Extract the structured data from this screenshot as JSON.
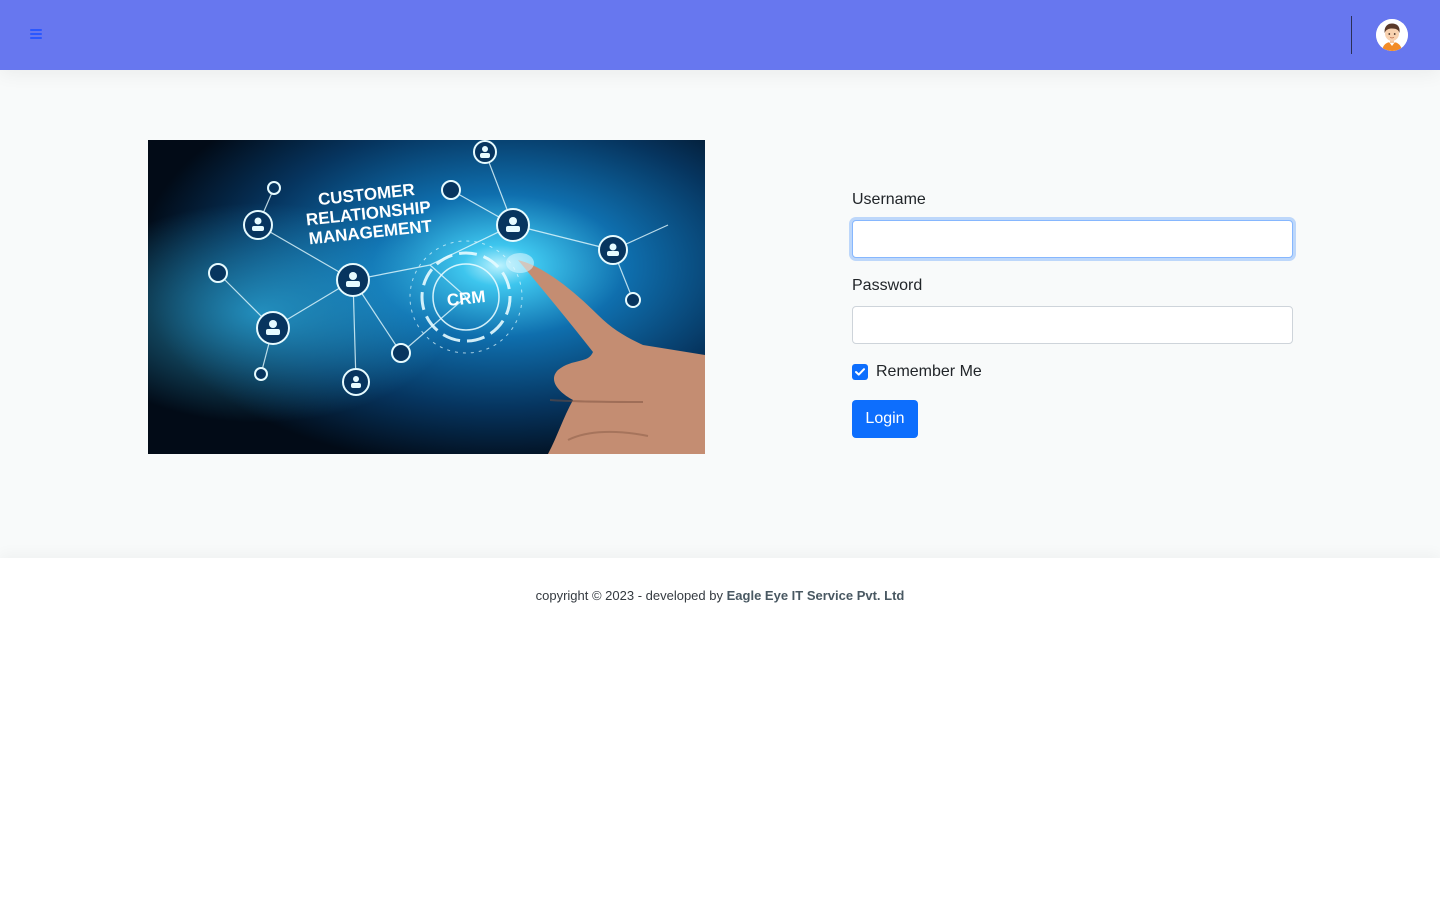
{
  "header": {
    "menu_icon": "bars-icon",
    "avatar_icon": "user-avatar-icon",
    "colors": {
      "background": "#6777ef",
      "menu_icon": "#2a57ff"
    }
  },
  "hero_image": {
    "heading_lines": [
      "CUSTOMER",
      "RELATIONSHIP",
      "MANAGEMENT"
    ],
    "badge": "CRM"
  },
  "login": {
    "username_label": "Username",
    "username_value": "",
    "password_label": "Password",
    "password_value": "",
    "remember_label": "Remember Me",
    "remember_checked": true,
    "submit_label": "Login",
    "colors": {
      "primary": "#0d6efd",
      "focus_border": "#86b7fe"
    }
  },
  "footer": {
    "text": "copyright © 2023 - developed by",
    "company": "Eagle Eye IT Service Pvt. Ltd"
  }
}
